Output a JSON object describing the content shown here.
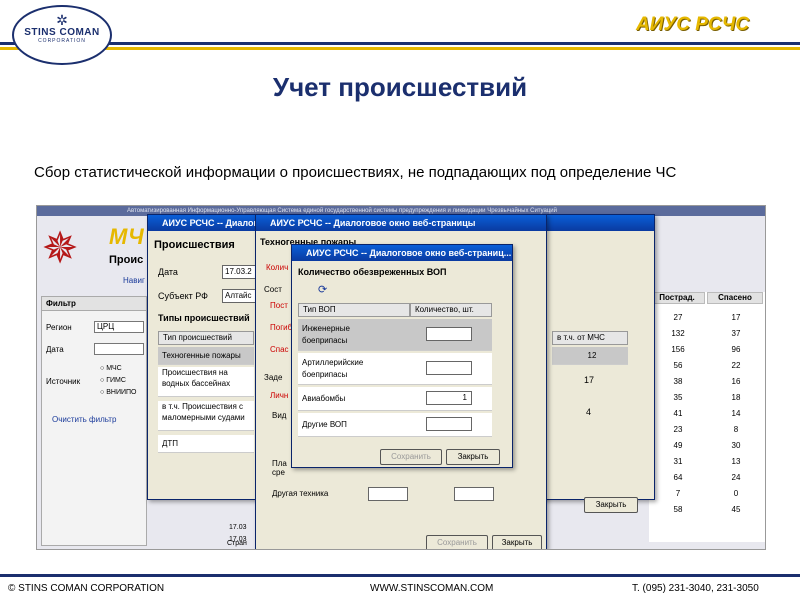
{
  "header": {
    "logo_mark": "✲",
    "logo_name": "STINS COMAN",
    "logo_sub": "CORPORATION",
    "brand": "АИУС РСЧС"
  },
  "title": "Учет происшествий",
  "description": "Сбор статистической информации о происшествиях, не подпадающих под определение ЧС",
  "app": {
    "banner": "Автоматизированная Информационно-Управляющая Система единой государственной системы предупреждения и ликвидации Чрезвычайных Ситуаций",
    "mchs_logo": "МЧ",
    "proish_label": "Проис",
    "navi_label": "Навиг",
    "filter": {
      "title": "Фильтр",
      "region_label": "Регион",
      "region_value": "ЦРЦ",
      "date_label": "Дата",
      "source_label": "Источник",
      "radio1": "МЧС",
      "radio2": "ГИМС",
      "radio3": "ВНИИПО",
      "clear_link": "Очистить фильтр"
    },
    "grid": {
      "col1": "Пострад.",
      "col2": "Спасено",
      "rows": [
        [
          "27",
          "17"
        ],
        [
          "132",
          "37"
        ],
        [
          "156",
          "96"
        ],
        [
          "56",
          "22"
        ],
        [
          "38",
          "16"
        ],
        [
          "35",
          "18"
        ],
        [
          "41",
          "14"
        ],
        [
          "23",
          "8"
        ],
        [
          "49",
          "30"
        ],
        [
          "31",
          "13"
        ],
        [
          "64",
          "24"
        ],
        [
          "7",
          "0"
        ],
        [
          "58",
          "45"
        ]
      ]
    }
  },
  "win1": {
    "title": "АИУС РСЧС -- Диалоговое окно веб-страницы",
    "heading": "Происшествия",
    "date_label": "Дата",
    "date_value": "17.03.2",
    "subject_label": "Субъект РФ",
    "subject_value": "Алтайс",
    "types_label": "Типы происшествий",
    "col_type": "Тип происшествий",
    "col_mchs": "в т.ч. от МЧС",
    "rows": [
      {
        "name": "Техногенные пожары",
        "val": "12"
      },
      {
        "name": "Происшествия на водных бассейнах",
        "val": "17"
      },
      {
        "name": "в т.ч. Происшествия с маломерными судами",
        "val": "4"
      },
      {
        "name": "ДТП",
        "val": ""
      }
    ],
    "close": "Закрыть",
    "row_left1": "17.03",
    "row_left2": "17.03",
    "pager": "Стран"
  },
  "win2": {
    "title": "АИУС РСЧС -- Диалоговое окно веб-страницы",
    "heading": "Техногенные пожары",
    "red1": "Колич",
    "red2": "Пост",
    "red3": "Погиб",
    "red4": "Спас",
    "box_label": "Сост",
    "box2_label": "Заде",
    "red5": "Личн",
    "other_tech": "Другая техника",
    "sub_row": "Пла сре",
    "view_label": "Вид",
    "save": "Сохранить",
    "close": "Закрыть",
    "mchs_tail": "ЧС"
  },
  "win3": {
    "title": "АИУС РСЧС -- Диалоговое окно веб-страниц...",
    "heading": "Количество обезвреженных ВОП",
    "col_type": "Тип ВОП",
    "col_count": "Количество, шт.",
    "rows": [
      {
        "name": "Инженерные боеприпасы",
        "val": ""
      },
      {
        "name": "Артиллерийские боеприпасы",
        "val": ""
      },
      {
        "name": "Авиабомбы",
        "val": "1"
      },
      {
        "name": "Другие ВОП",
        "val": ""
      }
    ],
    "save": "Сохранить",
    "close": "Закрыть"
  },
  "footer": {
    "left": "© STINS COMAN CORPORATION",
    "mid": "WWW.STINSCOMAN.COM",
    "right": "Т. (095) 231-3040, 231-3050"
  }
}
